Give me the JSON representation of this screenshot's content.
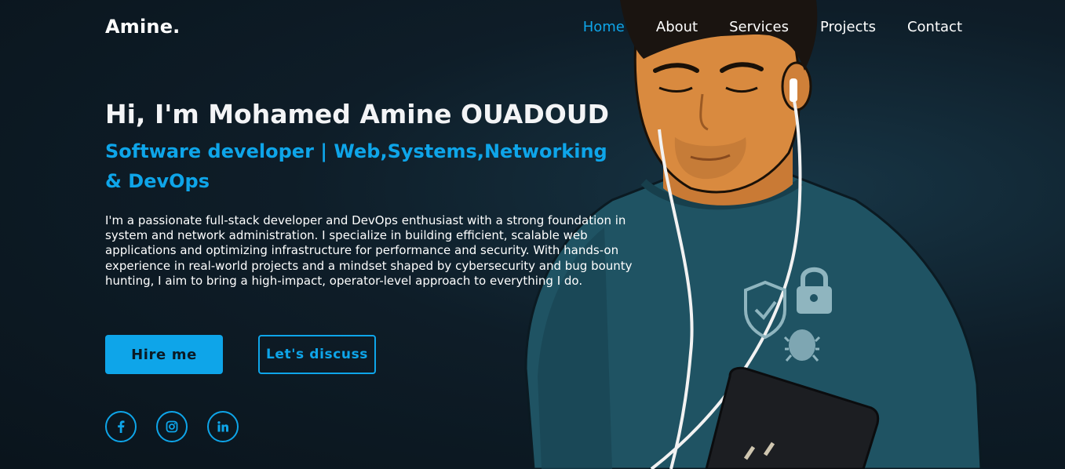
{
  "brand": {
    "logo": "Amine."
  },
  "nav": {
    "items": [
      {
        "label": "Home",
        "active": true
      },
      {
        "label": "About"
      },
      {
        "label": "Services"
      },
      {
        "label": "Projects"
      },
      {
        "label": "Contact"
      }
    ]
  },
  "hero": {
    "title": "Hi, I'm Mohamed Amine OUADOUD",
    "subtitle": "Software developer | Web,Systems,Networking & DevOps",
    "description": "I'm a passionate full-stack developer and DevOps enthusiast with a strong foundation in system and network administration. I specialize in building efficient, scalable web applications and optimizing infrastructure for performance and security. With hands-on experience in real-world projects and a mindset shaped by cybersecurity and bug bounty hunting, I aim to bring a high-impact, operator-level approach to everything I do.",
    "primary_button": "Hire me",
    "secondary_button": "Let's discuss"
  },
  "socials": [
    {
      "name": "facebook-icon"
    },
    {
      "name": "instagram-icon"
    },
    {
      "name": "linkedin-icon"
    }
  ],
  "colors": {
    "accent": "#0ea5e9",
    "background": "#0c1720",
    "text": "#ffffff"
  }
}
